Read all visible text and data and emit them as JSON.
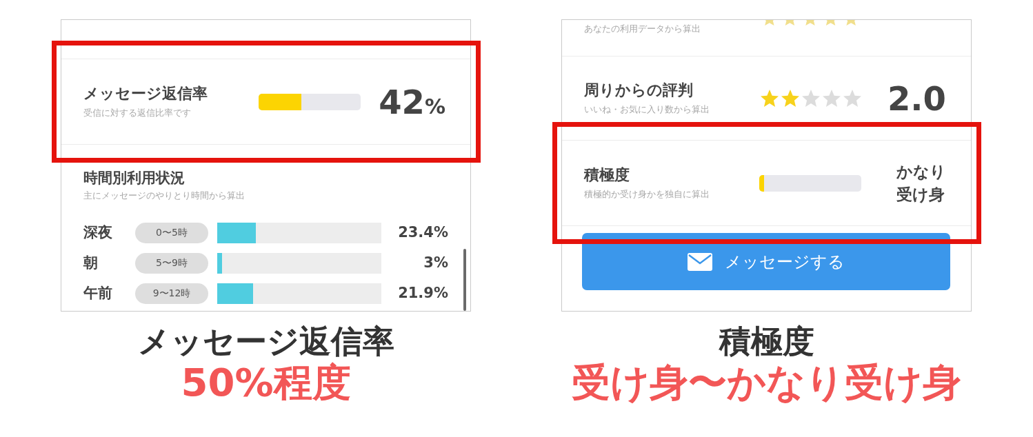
{
  "panels": [
    {
      "scrollbar": true,
      "rows": [
        {
          "kind": "meter",
          "title": "メッセージ返信率",
          "subtitle": "受信に対する返信比率です",
          "level": 0.42,
          "value": {
            "kind": "number",
            "text": "42",
            "unit": "%"
          },
          "highlighted": true
        }
      ],
      "section": {
        "title": "時間別利用状況",
        "subtitle": "主にメッセージのやりとり時間から算出",
        "items": [
          {
            "label": "深夜",
            "range": "0〜5時",
            "level": 0.234,
            "value": "23.4%"
          },
          {
            "label": "朝",
            "range": "5〜9時",
            "level": 0.03,
            "value": "3%"
          },
          {
            "label": "午前",
            "range": "9〜12時",
            "level": 0.219,
            "value": "21.9%"
          }
        ]
      },
      "caption": {
        "title": "メッセージ返信率",
        "note": "50%程度"
      }
    },
    {
      "rows": [
        {
          "kind": "cutoff",
          "subtitle": "あなたの利用データから算出"
        },
        {
          "kind": "stars",
          "title": "周りからの評判",
          "subtitle": "いいね・お気に入り数から算出",
          "stars": 2,
          "value": {
            "kind": "number",
            "text": "2.0"
          }
        },
        {
          "kind": "meter",
          "title": "積極度",
          "subtitle": "積極的か受け身かを独自に算出",
          "level": 0.05,
          "value": {
            "kind": "words",
            "lines": [
              "かなり",
              "受け身"
            ]
          },
          "highlighted": true
        }
      ],
      "button": {
        "label": "メッセージする"
      },
      "caption": {
        "title": "積極度",
        "note": "受け身〜かなり受け身"
      }
    }
  ]
}
